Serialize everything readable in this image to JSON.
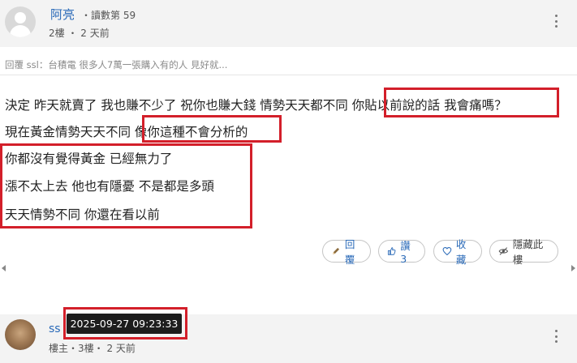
{
  "post": {
    "username": "阿亮",
    "reads": "・讀數第 59",
    "floor": "2樓 ・ 2 天前",
    "quote": "回覆 ssl：台積電 很多人7萬一張購入有的人 見好就...",
    "lines": [
      "決定 昨天就賣了 我也賺不少了 祝你也賺大錢 情勢天天都不同 你貼以前說的話 我會痛嗎？",
      "現在黃金情勢天天不同 像你這種不會分析的",
      "你都沒有覺得黃金 已經無力了",
      "漲不太上去 他也有隱憂 不是都是多頭",
      "天天情勢不同 你還在看以前"
    ]
  },
  "actions": {
    "reply": "回覆",
    "like": "讚 3",
    "favorite": "收藏",
    "hide": "隱藏此樓"
  },
  "next_post": {
    "username": "ss",
    "floor": "樓主・3樓・ 2 天前",
    "tooltip": "2025-09-27 09:23:33"
  },
  "icons": {
    "more": "more-vertical-icon",
    "reply": "pencil-icon",
    "like": "thumbs-up-icon",
    "favorite": "heart-icon",
    "hide": "eye-slash-icon"
  },
  "colors": {
    "accent": "#2a6ab8",
    "highlight": "#d31f2a"
  }
}
